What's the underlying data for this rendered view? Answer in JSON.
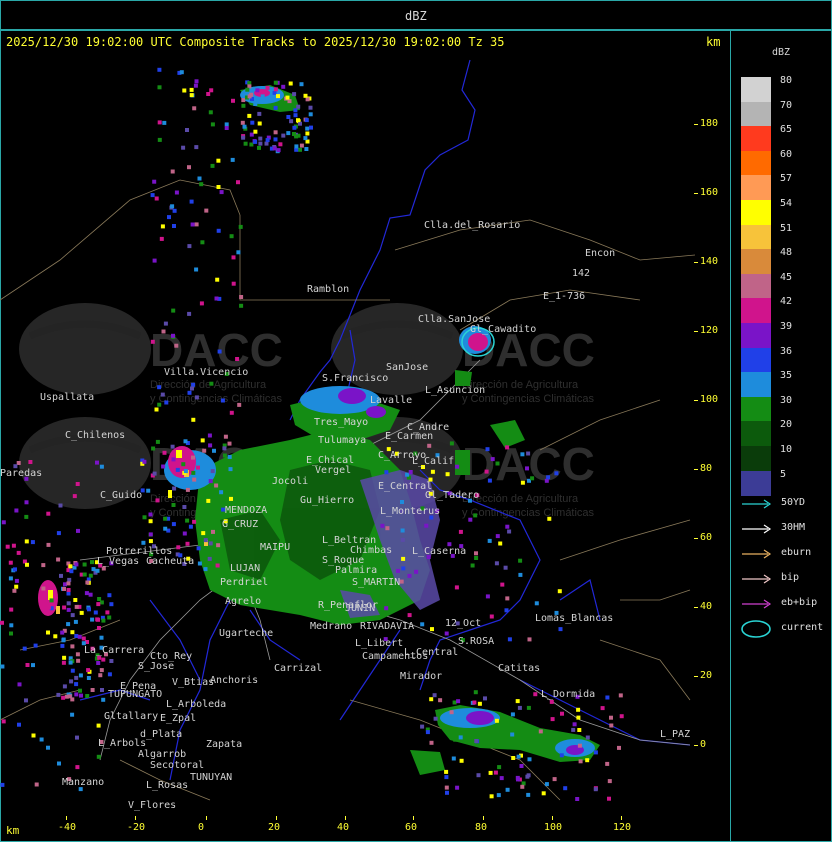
{
  "window": {
    "title": "dBZ"
  },
  "header": {
    "text": "2025/12/30 19:02:00 UTC Composite Tracks to 2025/12/30 19:02:00 Tz 35",
    "km_label": "km"
  },
  "axes": {
    "y_ticks": [
      "180",
      "160",
      "140",
      "120",
      "100",
      "80",
      "60",
      "40",
      "20",
      "0"
    ],
    "x_ticks": [
      "-40",
      "-20",
      "0",
      "20",
      "40",
      "60",
      "80",
      "100",
      "120"
    ],
    "x_unit": "km"
  },
  "legend": {
    "title": "dBZ",
    "levels": [
      {
        "label": "80",
        "color": "#d2d2d2"
      },
      {
        "label": "70",
        "color": "#b4b4b4"
      },
      {
        "label": "65",
        "color": "#ff3a1e"
      },
      {
        "label": "60",
        "color": "#ff6a00"
      },
      {
        "label": "57",
        "color": "#ff9a55"
      },
      {
        "label": "54",
        "color": "#ffff00"
      },
      {
        "label": "51",
        "color": "#f7c33a"
      },
      {
        "label": "48",
        "color": "#d98a3a"
      },
      {
        "label": "45",
        "color": "#c06488"
      },
      {
        "label": "42",
        "color": "#d0148c"
      },
      {
        "label": "39",
        "color": "#7a14c8"
      },
      {
        "label": "36",
        "color": "#2040e8"
      },
      {
        "label": "35",
        "color": "#1e8cdc"
      },
      {
        "label": "30",
        "color": "#148c14"
      },
      {
        "label": "20",
        "color": "#0c5a0c"
      },
      {
        "label": "10",
        "color": "#0a3c0a"
      },
      {
        "label": "5",
        "color": "#3c3c96"
      }
    ],
    "tracks": [
      {
        "label": "50YD",
        "color": "#2ad4d4"
      },
      {
        "label": "30HM",
        "color": "#ffffff"
      },
      {
        "label": "eburn",
        "color": "#e8b060"
      },
      {
        "label": "bip",
        "color": "#f0c8c8"
      },
      {
        "label": "eb+bip",
        "color": "#d040d0"
      },
      {
        "label": "current",
        "color": "#2ad4d4"
      }
    ]
  },
  "watermark": {
    "text": "DACC",
    "subtitle": "Dirección de Agricultura y Contingencias Climáticas"
  },
  "places": [
    {
      "name": "Clla.del_Rosario"
    },
    {
      "name": "Encon"
    },
    {
      "name": "Ramblon"
    },
    {
      "name": "E_1-736"
    },
    {
      "name": "142"
    },
    {
      "name": "Clla.SanJose"
    },
    {
      "name": "Gl_Cawadito"
    },
    {
      "name": "Villa.Vicencio"
    },
    {
      "name": "Uspallata"
    },
    {
      "name": "S.Francisco"
    },
    {
      "name": "SanJose"
    },
    {
      "name": "L_Asuncion"
    },
    {
      "name": "C_Chilenos"
    },
    {
      "name": "Lavalle"
    },
    {
      "name": "Tres_Mayo"
    },
    {
      "name": "Tulumaya"
    },
    {
      "name": "C_Andre"
    },
    {
      "name": "E_Carmen"
    },
    {
      "name": "L_Calif"
    },
    {
      "name": "C_Arroyo"
    },
    {
      "name": "E_Chical"
    },
    {
      "name": "Vergel"
    },
    {
      "name": "E_Central"
    },
    {
      "name": "Jocoli"
    },
    {
      "name": "Gl_Tadero"
    },
    {
      "name": "C_Guido"
    },
    {
      "name": "Gu_Hierro"
    },
    {
      "name": "L_Monterus"
    },
    {
      "name": "MENDOZA"
    },
    {
      "name": "G_CRUZ"
    },
    {
      "name": "L_Beltran"
    },
    {
      "name": "Chimbas"
    },
    {
      "name": "L_Caserna"
    },
    {
      "name": "Potrerillos"
    },
    {
      "name": "Cacheuta"
    },
    {
      "name": "MAIPU"
    },
    {
      "name": "S_Roque"
    },
    {
      "name": "Palmira"
    },
    {
      "name": "L_Vegas"
    },
    {
      "name": "LUJAN"
    },
    {
      "name": "S_MARTIN"
    },
    {
      "name": "Perdriel"
    },
    {
      "name": "Agrelo"
    },
    {
      "name": "R_Penaflor"
    },
    {
      "name": "Ugarteche"
    },
    {
      "name": "Medrano"
    },
    {
      "name": "RIVADAVIA"
    },
    {
      "name": "JUNIN"
    },
    {
      "name": "12_Oct"
    },
    {
      "name": "S.ROSA"
    },
    {
      "name": "Lomas_Blancas"
    },
    {
      "name": "La_Carrera"
    },
    {
      "name": "Cto_Rey"
    },
    {
      "name": "S_Jose"
    },
    {
      "name": "L_Libert"
    },
    {
      "name": "Campamentos"
    },
    {
      "name": "L_Central"
    },
    {
      "name": "Carrizal"
    },
    {
      "name": "Catitas"
    },
    {
      "name": "E_Pena"
    },
    {
      "name": "V_Btias"
    },
    {
      "name": "Anchoris"
    },
    {
      "name": "TUPUNGATO"
    },
    {
      "name": "L_Arboleda"
    },
    {
      "name": "Mirador"
    },
    {
      "name": "L_Dormida"
    },
    {
      "name": "Gltallary"
    },
    {
      "name": "E_Zpal"
    },
    {
      "name": "L_Arbols"
    },
    {
      "name": "d_Plata"
    },
    {
      "name": "Zapata"
    },
    {
      "name": "Algarrob"
    },
    {
      "name": "Secotoral"
    },
    {
      "name": "TUNUYAN"
    },
    {
      "name": "Manzano"
    },
    {
      "name": "L_Rosas"
    },
    {
      "name": "V_Flores"
    },
    {
      "name": "Paredas"
    },
    {
      "name": "L_PAZ"
    }
  ]
}
